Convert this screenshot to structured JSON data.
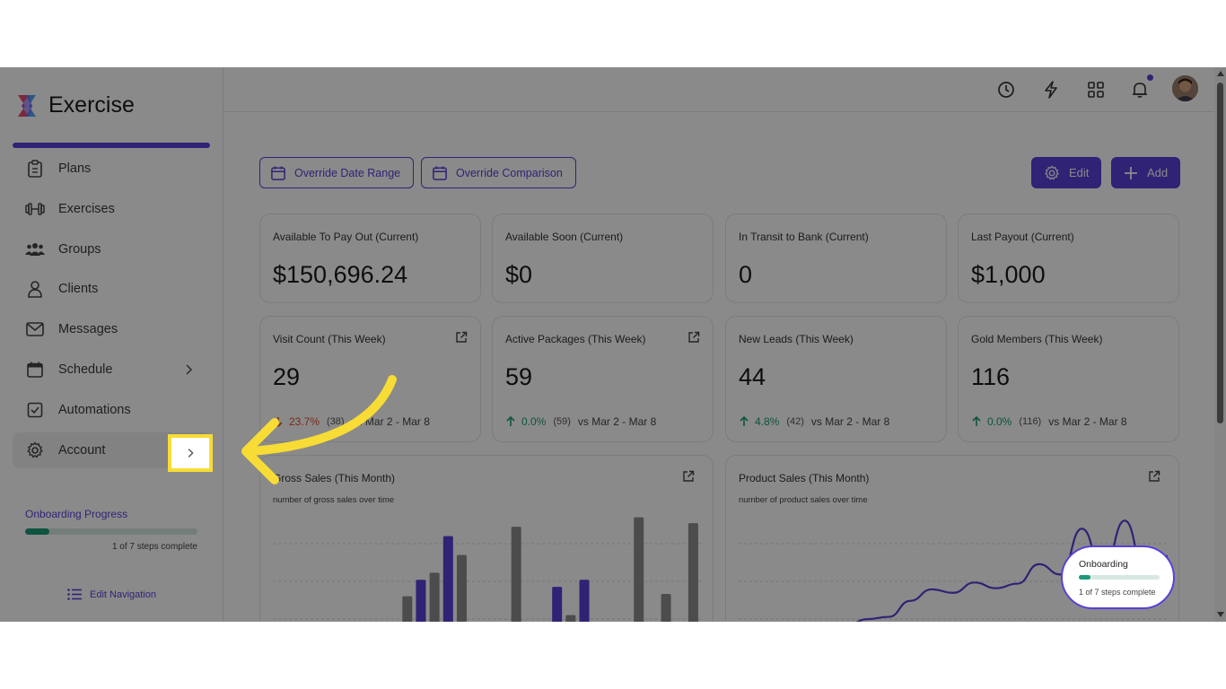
{
  "app": {
    "title": "Exercise"
  },
  "sidebar": {
    "items": [
      {
        "label": "Plans",
        "icon": "clipboard-icon"
      },
      {
        "label": "Exercises",
        "icon": "dumbbell-icon"
      },
      {
        "label": "Groups",
        "icon": "users-icon"
      },
      {
        "label": "Clients",
        "icon": "user-icon"
      },
      {
        "label": "Messages",
        "icon": "envelope-icon"
      },
      {
        "label": "Schedule",
        "icon": "calendar-icon"
      },
      {
        "label": "Automations",
        "icon": "checkbox-icon"
      },
      {
        "label": "Account",
        "icon": "gear-icon"
      }
    ],
    "onboarding": {
      "title": "Onboarding Progress",
      "subtitle": "1 of 7 steps complete",
      "progress": 0.14
    },
    "edit_nav_label": "Edit Navigation"
  },
  "toolbar": {
    "override_date_label": "Override Date Range",
    "override_comparison_label": "Override Comparison",
    "edit_label": "Edit",
    "add_label": "Add"
  },
  "stats_row1": [
    {
      "title": "Available To Pay Out (Current)",
      "value": "$150,696.24"
    },
    {
      "title": "Available Soon (Current)",
      "value": "$0"
    },
    {
      "title": "In Transit to Bank (Current)",
      "value": "0"
    },
    {
      "title": "Last Payout (Current)",
      "value": "$1,000"
    }
  ],
  "stats_row2": [
    {
      "title": "Visit Count (This Week)",
      "value": "29",
      "change": "23.7%",
      "direction": "down",
      "count": "(38)",
      "range": "vs Mar 2 - Mar 8"
    },
    {
      "title": "Active Packages (This Week)",
      "value": "59",
      "change": "0.0%",
      "direction": "up",
      "count": "(59)",
      "range": "vs Mar 2 - Mar 8"
    },
    {
      "title": "New Leads (This Week)",
      "value": "44",
      "change": "4.8%",
      "direction": "up",
      "count": "(42)",
      "range": "vs Mar 2 - Mar 8"
    },
    {
      "title": "Gold Members (This Week)",
      "value": "116",
      "change": "0.0%",
      "direction": "up",
      "count": "(116)",
      "range": "vs Mar 2 - Mar 8"
    }
  ],
  "gross_sales": {
    "title": "Gross Sales (This Month)",
    "subtitle": "number of gross sales over time"
  },
  "product_sales": {
    "title": "Product Sales (This Month)",
    "subtitle": "number of product sales over time"
  },
  "onboarding_bubble": {
    "title": "Onboarding",
    "subtitle": "1 of 7 steps complete",
    "progress": 0.14
  },
  "colors": {
    "accent": "#5a3fd8",
    "success": "#1c9a78",
    "danger": "#e64a2e",
    "highlight": "#f7dc35"
  },
  "chart_data": [
    {
      "type": "bar",
      "title": "Gross Sales (This Month)",
      "subtitle": "number of gross sales over time",
      "series": [
        {
          "values": [
            0.01,
            0,
            0,
            0,
            0,
            0,
            0,
            0.33,
            0.47,
            0.53,
            0.84,
            0.68,
            0,
            0.06,
            0,
            0.92,
            0,
            0.08,
            0.41,
            0.17,
            0.47,
            0.08,
            0,
            0,
            1.0,
            0,
            0.35,
            0,
            0.95
          ]
        }
      ],
      "highlight_indices": [
        0,
        8,
        10,
        18,
        20
      ],
      "ylim": [
        0,
        1.05
      ]
    },
    {
      "type": "line",
      "title": "Product Sales (This Month)",
      "subtitle": "number of product sales over time",
      "series": [
        {
          "values": [
            0,
            0,
            0,
            0.04,
            0.06,
            0.08,
            0.14,
            0.16,
            0.3,
            0.4,
            0.37,
            0.46,
            0.41,
            0.45,
            0.62,
            0.53,
            0.93,
            0.57,
            1.0,
            0.52,
            0.69
          ]
        }
      ],
      "ylim": [
        0,
        1.05
      ]
    }
  ]
}
